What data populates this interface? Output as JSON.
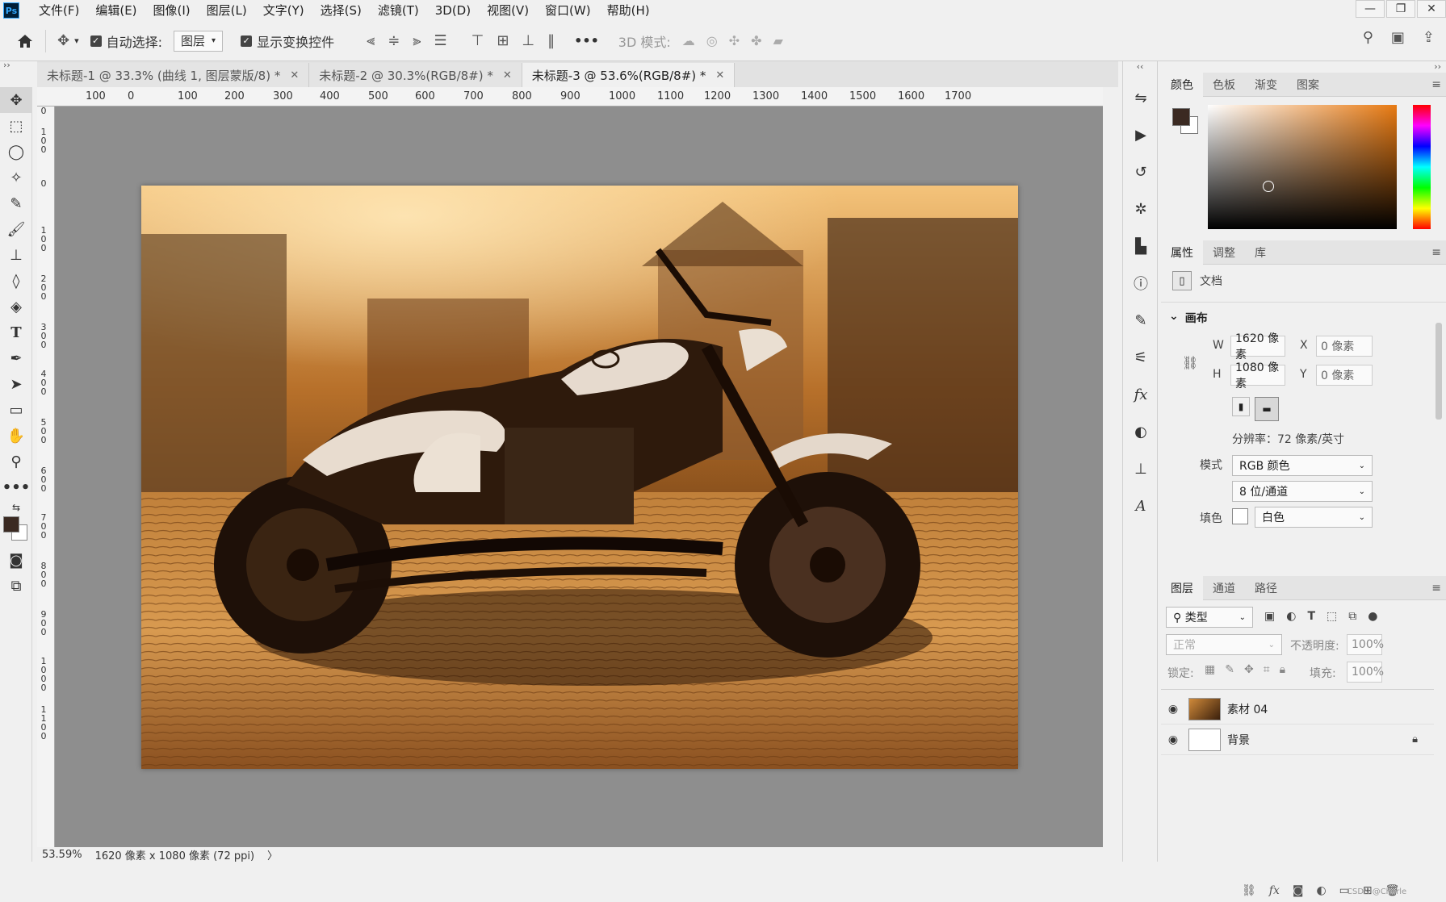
{
  "app": {
    "logo": "Ps"
  },
  "menu": [
    "文件(F)",
    "编辑(E)",
    "图像(I)",
    "图层(L)",
    "文字(Y)",
    "选择(S)",
    "滤镜(T)",
    "3D(D)",
    "视图(V)",
    "窗口(W)",
    "帮助(H)"
  ],
  "window_buttons": [
    "—",
    "❐",
    "✕"
  ],
  "options": {
    "auto_select_label": "自动选择:",
    "auto_select_value": "图层",
    "show_transform_label": "显示变换控件",
    "more": "•••",
    "mode_3d_label": "3D 模式:"
  },
  "tabs": [
    {
      "label": "未标题-1 @ 33.3% (曲线 1, 图层蒙版/8) *",
      "active": false
    },
    {
      "label": "未标题-2 @ 30.3%(RGB/8#) *",
      "active": false
    },
    {
      "label": "未标题-3 @ 53.6%(RGB/8#) *",
      "active": true
    }
  ],
  "ruler_h": [
    "100",
    "0",
    "100",
    "200",
    "300",
    "400",
    "500",
    "600",
    "700",
    "800",
    "900",
    "1000",
    "1100",
    "1200",
    "1300",
    "1400",
    "1500",
    "1600",
    "1700"
  ],
  "ruler_v": [
    "0",
    "100",
    "0",
    "100",
    "200",
    "300",
    "400",
    "500",
    "600",
    "700",
    "800",
    "900",
    "1000",
    "1100"
  ],
  "status": {
    "zoom": "53.59%",
    "doc_info": "1620 像素 x 1080 像素 (72 ppi)",
    "arrow": "〉"
  },
  "color_panel": {
    "tabs": [
      "颜色",
      "色板",
      "渐变",
      "图案"
    ],
    "fg": "#3b2a22",
    "bg": "#ffffff"
  },
  "properties": {
    "tabs": [
      "属性",
      "调整",
      "库"
    ],
    "doc_label": "文档",
    "section": "画布",
    "w_label": "W",
    "w_value": "1620 像素",
    "h_label": "H",
    "h_value": "1080 像素",
    "x_label": "X",
    "x_value": "0 像素",
    "y_label": "Y",
    "y_value": "0 像素",
    "resolution": "分辨率：72 像素/英寸",
    "mode_label": "模式",
    "mode_value": "RGB 颜色",
    "depth_value": "8 位/通道",
    "fill_label": "填色",
    "fill_value": "白色"
  },
  "layers": {
    "tabs": [
      "图层",
      "通道",
      "路径"
    ],
    "filter_label": "类型",
    "blend_mode": "正常",
    "opacity_label": "不透明度:",
    "opacity_value": "100%",
    "lock_label": "锁定:",
    "fill_label": "填充:",
    "fill_value": "100%",
    "items": [
      {
        "name": "素材 04",
        "locked": false
      },
      {
        "name": "背景",
        "locked": true
      }
    ],
    "footer_icons": [
      "link-icon",
      "fx-icon",
      "mask-icon",
      "adjustment-icon",
      "folder-icon",
      "new-layer-icon",
      "trash-icon"
    ],
    "watermark": "CSDN @Charle"
  }
}
